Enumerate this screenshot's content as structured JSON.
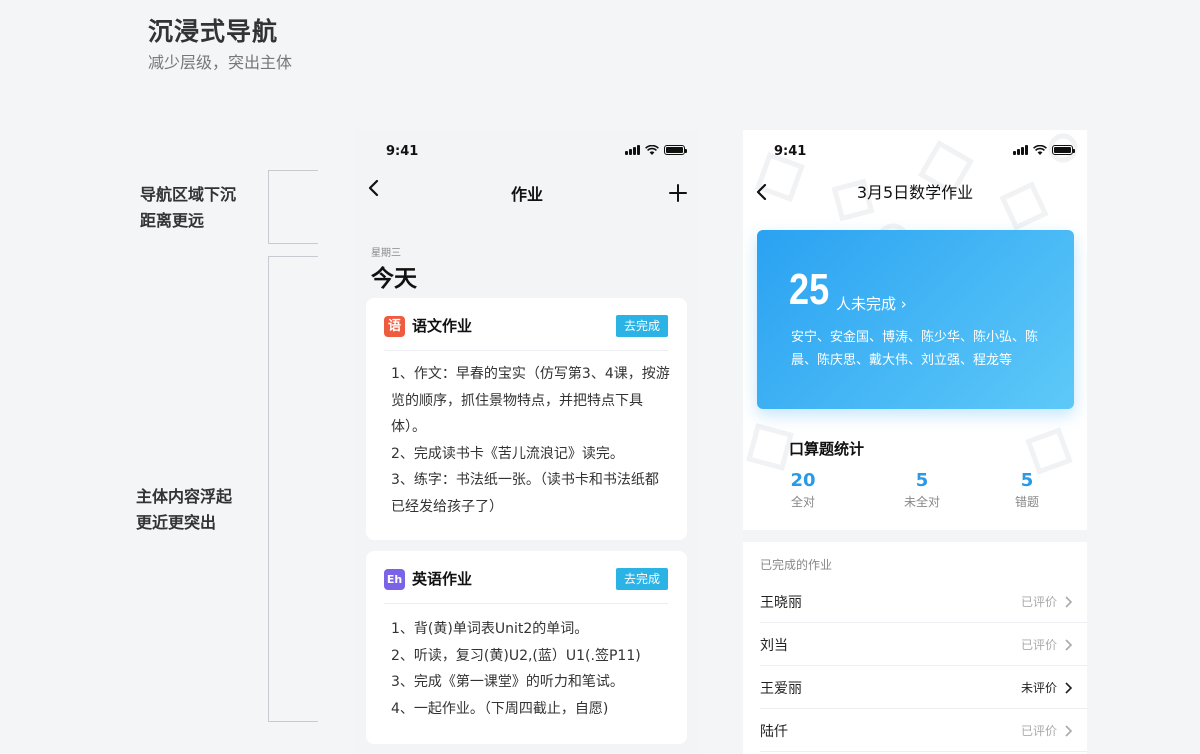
{
  "header": {
    "title": "沉浸式导航",
    "subtitle": "减少层级，突出主体"
  },
  "annotations": {
    "nav": [
      "导航区域下沉",
      "距离更远"
    ],
    "body": [
      "主体内容浮起",
      "更近更突出"
    ]
  },
  "phone1": {
    "status_time": "9:41",
    "nav_title": "作业",
    "weekday": "星期三",
    "today": "今天",
    "cards": [
      {
        "icon_text": "语",
        "icon_color": "#ee5b3f",
        "title": "语文作业",
        "button": "去完成",
        "lines": [
          "1、作文：早春的宝实（仿写第3、4课，按游览的顺序，抓住景物特点，并把特点下具体）。",
          "2、完成读书卡《苦儿流浪记》读完。",
          "3、练字：书法纸一张。（读书卡和书法纸都已经发给孩子了）"
        ]
      },
      {
        "icon_text": "Eh",
        "icon_color": "#7a63e8",
        "title": "英语作业",
        "button": "去完成",
        "lines": [
          "1、背(黄)单词表Unit2的单词。",
          "2、听读，复习(黄)U2,(蓝）U1(.签P11)",
          "3、完成《第一课堂》的听力和笔试。",
          "4、一起作业。（下周四截止，自愿)"
        ]
      }
    ]
  },
  "phone2": {
    "status_time": "9:41",
    "nav_title": "3月5日数学作业",
    "hero": {
      "count": "25",
      "label": "人未完成 ›",
      "names": "安宁、安金国、博涛、陈少华、陈小弘、陈晨、陈庆思、戴大伟、刘立强、程龙等"
    },
    "stats": {
      "title": "口算题统计",
      "items": [
        {
          "value": "20",
          "label": "全对"
        },
        {
          "value": "5",
          "label": "未全对"
        },
        {
          "value": "5",
          "label": "错题"
        }
      ]
    },
    "list": {
      "header": "已完成的作业",
      "rows": [
        {
          "name": "王晓丽",
          "status": "已评价",
          "pending": false
        },
        {
          "name": "刘当",
          "status": "已评价",
          "pending": false
        },
        {
          "name": "王爱丽",
          "status": "未评价",
          "pending": true
        },
        {
          "name": "陆仟",
          "status": "已评价",
          "pending": false
        }
      ]
    }
  },
  "colors": {
    "accent_blue": "#2bb3e6",
    "hero_start": "#2aa2f2",
    "hero_end": "#5ec9f8",
    "stat_value": "#2a9ae6"
  }
}
